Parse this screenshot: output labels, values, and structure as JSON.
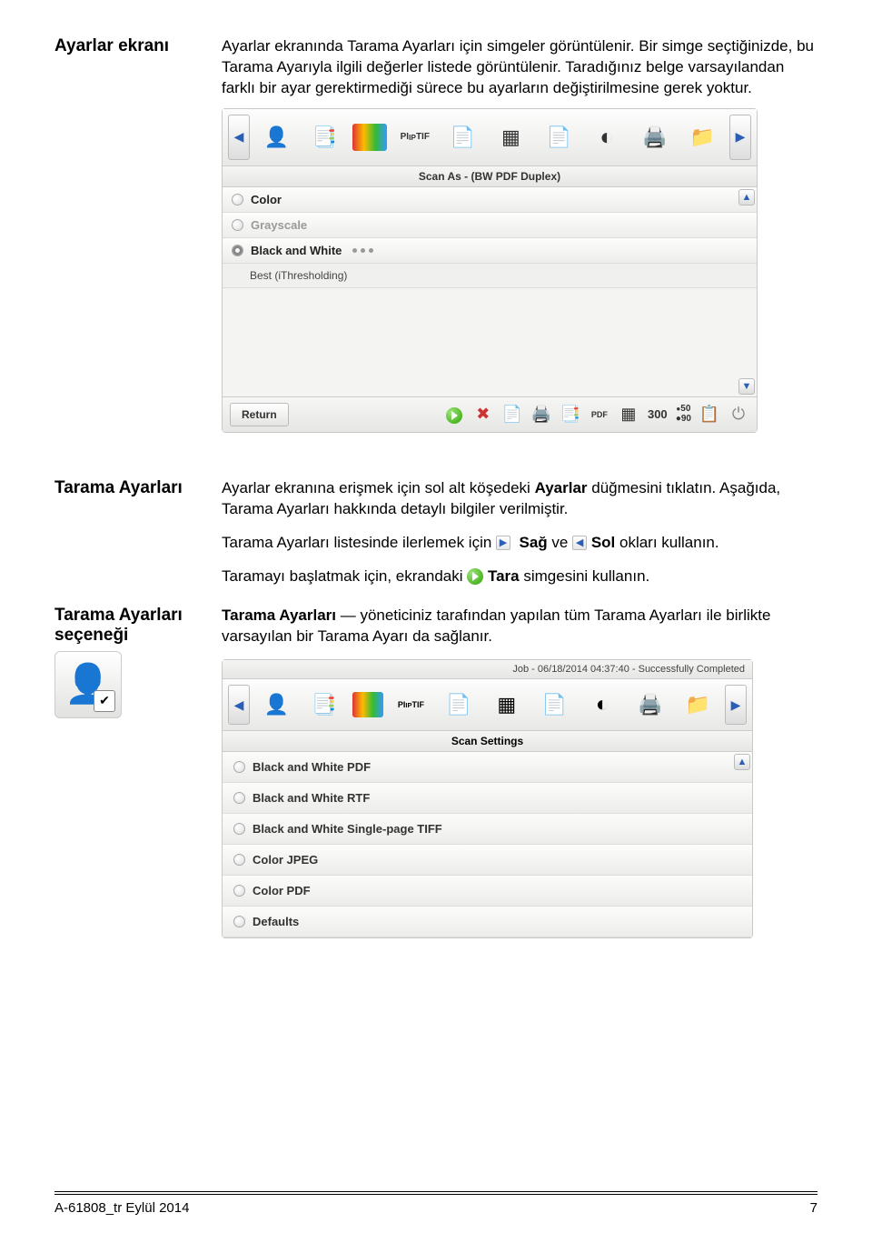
{
  "sec1": {
    "heading": "Ayarlar ekranı",
    "para": "Ayarlar ekranında Tarama Ayarları için simgeler görüntülenir. Bir simge seçtiğinizde, bu Tarama Ayarıyla ilgili değerler listede görüntülenir. Taradığınız belge varsayılandan farklı bir ayar gerektirmediği sürece bu ayarların değiştirilmesine gerek yoktur."
  },
  "panel1": {
    "caption": "Scan As - (BW PDF Duplex)",
    "items": [
      {
        "label": "Color",
        "selected": false,
        "gray": false
      },
      {
        "label": "Grayscale",
        "selected": false,
        "gray": true
      },
      {
        "label": "Black and White",
        "selected": true,
        "gray": false,
        "dots": true,
        "sub": "Best (iThresholding)"
      }
    ],
    "return_label": "Return",
    "dpi_main": "300",
    "dpi_small_top": "50",
    "dpi_small_bot": "90"
  },
  "sec2": {
    "heading": "Tarama Ayarları",
    "p1a": "Ayarlar ekranına erişmek için sol alt köşedeki ",
    "p1b": "Ayarlar",
    "p1c": " düğmesini tıklatın. Aşağıda, Tarama Ayarları hakkında detaylı bilgiler verilmiştir.",
    "p2a": "Tarama Ayarları listesinde ilerlemek için ",
    "p2_sag": "Sağ",
    "p2_ve": " ve ",
    "p2_sol": "Sol",
    "p2b": " okları kullanın.",
    "p3a": "Taramayı başlatmak için, ekrandaki ",
    "p3_tara": "Tara",
    "p3b": " simgesini kullanın."
  },
  "sec3": {
    "heading": "Tarama Ayarları seçeneği",
    "p1_bold": "Tarama Ayarları",
    "p1_rest": " — yöneticiniz tarafından yapılan tüm Tarama Ayarları ile birlikte varsayılan bir Tarama Ayarı da sağlanır."
  },
  "panel2": {
    "titlebar": "Job - 06/18/2014 04:37:40 - Successfully Completed",
    "caption": "Scan Settings",
    "items": [
      "Black and White PDF",
      "Black and White RTF",
      "Black and White Single-page TIFF",
      "Color JPEG",
      "Color PDF",
      "Defaults"
    ]
  },
  "footer": {
    "left": "A-61808_tr  Eylül 2014",
    "right": "7"
  }
}
